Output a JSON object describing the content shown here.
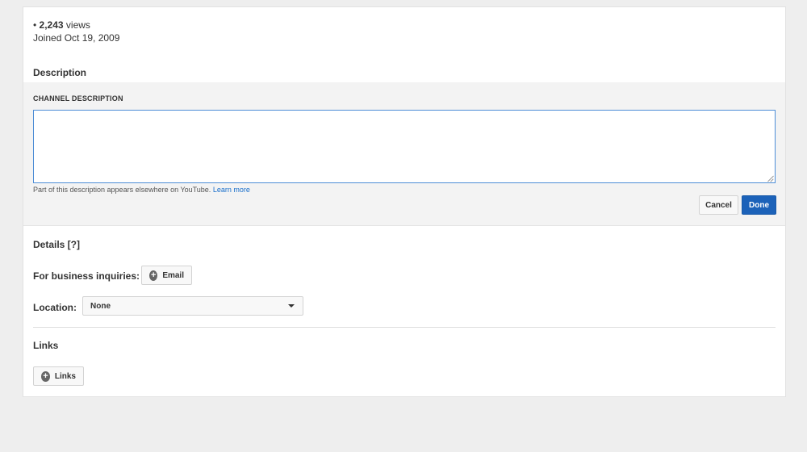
{
  "stats": {
    "views": "2,243",
    "views_suffix": " views",
    "joined": "Joined Oct 19, 2009"
  },
  "description": {
    "section_title": "Description",
    "field_label": "CHANNEL DESCRIPTION",
    "value": "",
    "help_text": "Part of this description appears elsewhere on YouTube.",
    "learn_more": "Learn more",
    "cancel_label": "Cancel",
    "done_label": "Done"
  },
  "details": {
    "section_title": "Details [?]",
    "business_label": "For business inquiries:",
    "email_label": "Email",
    "location_label": "Location:",
    "location_value": "None"
  },
  "links": {
    "section_title": "Links",
    "add_label": "Links"
  },
  "icons": {
    "add": "plus-circle-icon",
    "dropdown": "caret-down-icon"
  },
  "colors": {
    "primary_button": "#1c62b9",
    "link": "#1a6fcb",
    "focus_border": "#4d8dd6"
  }
}
